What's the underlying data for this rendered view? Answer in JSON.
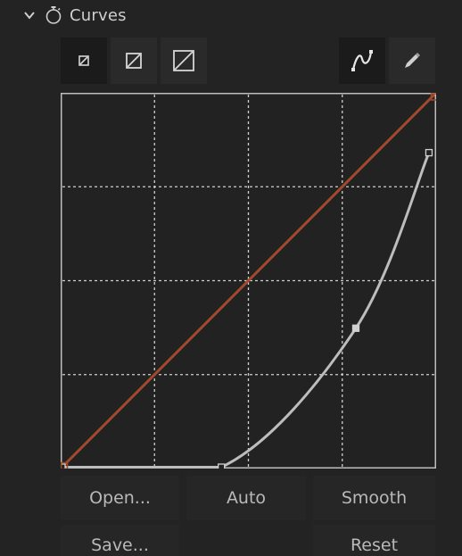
{
  "panel": {
    "title": "Curves",
    "expanded": true,
    "icons": {
      "collapse": "chevron-down-icon",
      "effect": "stopwatch-icon"
    }
  },
  "toolbar": {
    "size_buttons": [
      {
        "name": "small-graph-size",
        "icon": "graph-size-small-icon",
        "active": true
      },
      {
        "name": "medium-graph-size",
        "icon": "graph-size-medium-icon",
        "active": false
      },
      {
        "name": "large-graph-size",
        "icon": "graph-size-large-icon",
        "active": false
      }
    ],
    "mode_buttons": [
      {
        "name": "curve-tool",
        "icon": "bezier-curve-icon",
        "active": true
      },
      {
        "name": "pencil-tool",
        "icon": "pencil-icon",
        "active": false
      }
    ]
  },
  "curve": {
    "grid_divisions": 4,
    "range": [
      0,
      255
    ],
    "diagonal_color": "#a24a2a",
    "curve_color": "#bdbdbd",
    "points": [
      {
        "in": 0,
        "out": 0
      },
      {
        "in": 109,
        "out": 0
      },
      {
        "in": 201,
        "out": 95
      },
      {
        "in": 251,
        "out": 215
      }
    ]
  },
  "buttons": {
    "open": "Open...",
    "auto": "Auto",
    "smooth": "Smooth",
    "save": "Save...",
    "reset": "Reset"
  }
}
